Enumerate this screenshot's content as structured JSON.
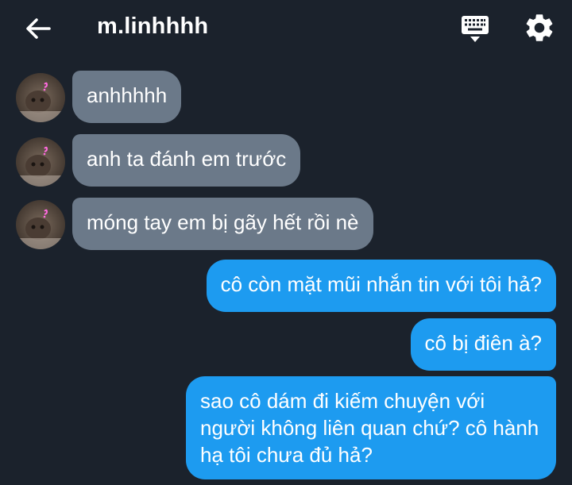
{
  "header": {
    "title": "m.linhhhh",
    "back_icon": "arrow-left-icon",
    "keyboard_icon": "keyboard-icon",
    "settings_icon": "gear-icon"
  },
  "messages": [
    {
      "sender": "them",
      "text": "anhhhhh"
    },
    {
      "sender": "them",
      "text": "anh ta đánh em trước"
    },
    {
      "sender": "them",
      "text": "móng tay em bị gãy hết rồi nè"
    },
    {
      "sender": "me",
      "text": "cô còn mặt mũi nhắn tin với tôi hả?"
    },
    {
      "sender": "me",
      "text": "cô bị điên à?"
    },
    {
      "sender": "me",
      "text": "sao cô dám đi kiếm chuyện với người không liên quan chứ? cô hành hạ tôi chưa đủ hả?"
    }
  ],
  "colors": {
    "background": "#1b222c",
    "incoming_bubble": "#6b7989",
    "outgoing_bubble": "#1d9bf0"
  }
}
